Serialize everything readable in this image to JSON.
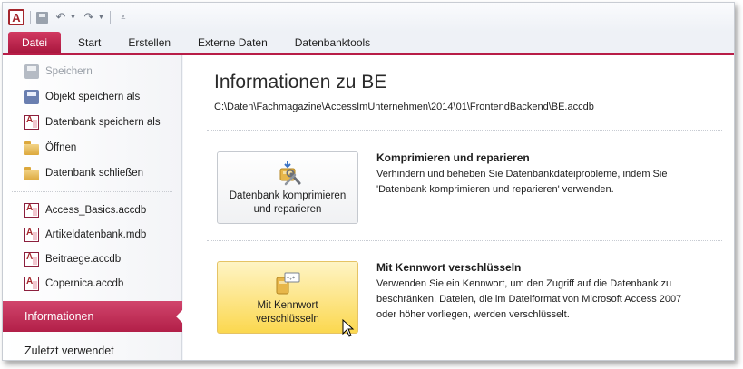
{
  "app": {
    "icon_letter": "A"
  },
  "qat": {
    "buttons": [
      "save-icon",
      "undo-icon",
      "redo-icon",
      "customize-icon"
    ]
  },
  "ribbon": {
    "tabs": [
      "Datei",
      "Start",
      "Erstellen",
      "Externe Daten",
      "Datenbanktools"
    ],
    "active_tab": "Datei",
    "accent": "#b81d47"
  },
  "nav": {
    "commands": [
      {
        "label": "Speichern",
        "icon": "save-icon",
        "enabled": false
      },
      {
        "label": "Objekt speichern als",
        "icon": "save-object-icon",
        "enabled": true
      },
      {
        "label": "Datenbank speichern als",
        "icon": "access-db-icon",
        "enabled": true
      },
      {
        "label": "Öffnen",
        "icon": "open-folder-icon",
        "enabled": true
      },
      {
        "label": "Datenbank schließen",
        "icon": "close-folder-icon",
        "enabled": true
      }
    ],
    "recent_files": [
      "Access_Basics.accdb",
      "Artikeldatenbank.mdb",
      "Beitraege.accdb",
      "Copernica.accdb"
    ],
    "sections": [
      {
        "label": "Informationen",
        "active": true
      },
      {
        "label": "Zuletzt verwendet",
        "active": false
      }
    ]
  },
  "info": {
    "title": "Informationen zu BE",
    "path": "C:\\Daten\\Fachmagazine\\AccessImUnternehmen\\2014\\01\\FrontendBackend\\BE.accdb",
    "compact": {
      "button_label": "Datenbank komprimieren\nund reparieren",
      "title": "Komprimieren und reparieren",
      "description": "Verhindern und beheben Sie Datenbankdateiprobleme, indem Sie 'Datenbank komprimieren und reparieren' verwenden."
    },
    "encrypt": {
      "button_label": "Mit Kennwort\nverschlüsseln",
      "title": "Mit Kennwort verschlüsseln",
      "description": "Verwenden Sie ein Kennwort, um den Zugriff auf die Datenbank zu beschränken. Dateien, die im Dateiformat von Microsoft Access 2007 oder höher vorliegen, werden verschlüsselt.",
      "hover_color": "#fde68b"
    }
  }
}
